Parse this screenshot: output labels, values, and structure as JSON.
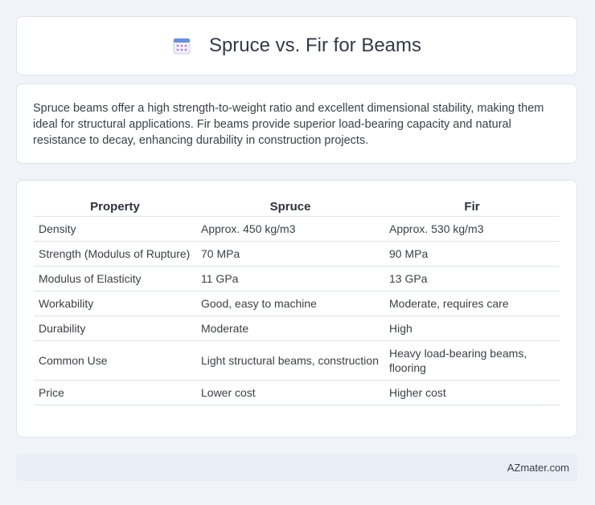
{
  "header": {
    "title": "Spruce vs. Fir for Beams",
    "icon": "calendar-icon"
  },
  "intro": {
    "text": "Spruce beams offer a high strength-to-weight ratio and excellent dimensional stability, making them ideal for structural applications. Fir beams provide superior load-bearing capacity and natural resistance to decay, enhancing durability in construction projects."
  },
  "table": {
    "headers": [
      "Property",
      "Spruce",
      "Fir"
    ],
    "rows": [
      [
        "Density",
        "Approx. 450 kg/m3",
        "Approx. 530 kg/m3"
      ],
      [
        "Strength (Modulus of Rupture)",
        "70 MPa",
        "90 MPa"
      ],
      [
        "Modulus of Elasticity",
        "11 GPa",
        "13 GPa"
      ],
      [
        "Workability",
        "Good, easy to machine",
        "Moderate, requires care"
      ],
      [
        "Durability",
        "Moderate",
        "High"
      ],
      [
        "Common Use",
        "Light structural beams, construction",
        "Heavy load-bearing beams, flooring"
      ],
      [
        "Price",
        "Lower cost",
        "Higher cost"
      ]
    ]
  },
  "footer": {
    "text": "AZmater.com"
  },
  "colors": {
    "background": "#f0f3f8",
    "card": "#ffffff",
    "footer": "#e9eef7",
    "icon_accent": "#6c8fd8"
  }
}
